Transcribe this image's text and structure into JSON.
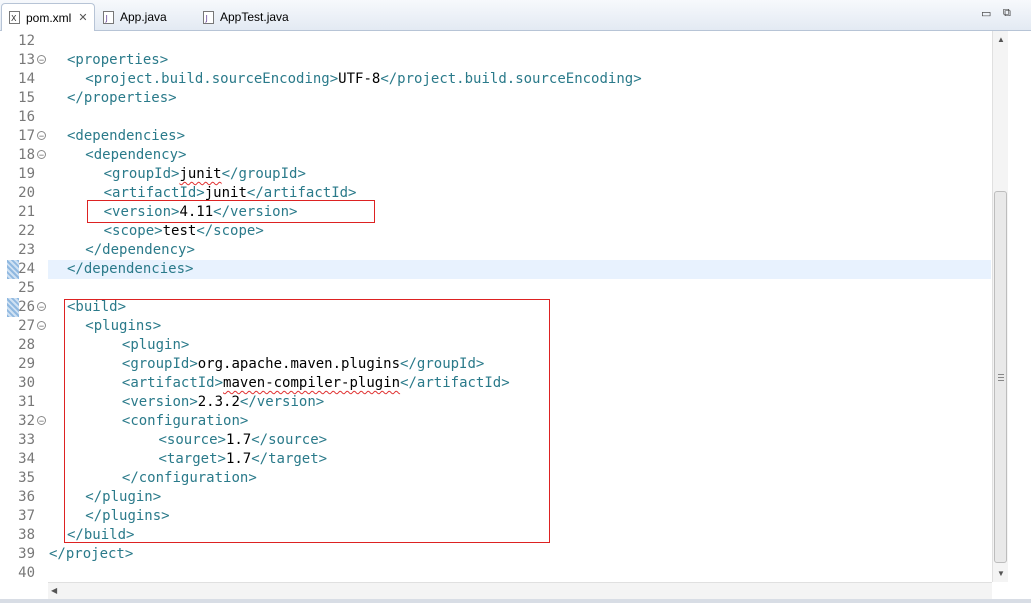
{
  "tabs": [
    {
      "label": "pom.xml",
      "active": true,
      "icon": "xml-file-icon"
    },
    {
      "label": "App.java",
      "active": false,
      "icon": "java-file-icon"
    },
    {
      "label": "AppTest.java",
      "active": false,
      "icon": "java-file-icon"
    }
  ],
  "window_controls": {
    "minimize": "▭",
    "maximize": "⧉"
  },
  "lines": [
    {
      "num": "12",
      "indent": 0,
      "parts": []
    },
    {
      "num": "13",
      "fold": true,
      "indent": 1,
      "parts": [
        [
          "tag",
          "<properties>"
        ]
      ]
    },
    {
      "num": "14",
      "indent": 2,
      "parts": [
        [
          "tag",
          "<project.build.sourceEncoding>"
        ],
        [
          "txt",
          "UTF-8"
        ],
        [
          "tag",
          "</project.build.sourceEncoding>"
        ]
      ]
    },
    {
      "num": "15",
      "indent": 1,
      "parts": [
        [
          "tag",
          "</properties>"
        ]
      ]
    },
    {
      "num": "16",
      "indent": 0,
      "parts": []
    },
    {
      "num": "17",
      "fold": true,
      "indent": 1,
      "parts": [
        [
          "tag",
          "<dependencies>"
        ]
      ]
    },
    {
      "num": "18",
      "fold": true,
      "indent": 2,
      "parts": [
        [
          "tag",
          "<dependency>"
        ]
      ]
    },
    {
      "num": "19",
      "indent": 3,
      "parts": [
        [
          "tag",
          "<groupId>"
        ],
        [
          "squig",
          "junit"
        ],
        [
          "tag",
          "</groupId>"
        ]
      ]
    },
    {
      "num": "20",
      "indent": 3,
      "parts": [
        [
          "tag",
          "<artifactId>"
        ],
        [
          "txt",
          "junit"
        ],
        [
          "tag",
          "</artifactId>"
        ]
      ]
    },
    {
      "num": "21",
      "indent": 3,
      "parts": [
        [
          "tag",
          "<version>"
        ],
        [
          "txt",
          "4.11"
        ],
        [
          "tag",
          "</version>"
        ]
      ]
    },
    {
      "num": "22",
      "indent": 3,
      "parts": [
        [
          "tag",
          "<scope>"
        ],
        [
          "txt",
          "test"
        ],
        [
          "tag",
          "</scope>"
        ]
      ]
    },
    {
      "num": "23",
      "indent": 2,
      "parts": [
        [
          "tag",
          "</dependency>"
        ]
      ]
    },
    {
      "num": "24",
      "indent": 1,
      "marker": true,
      "highlight": true,
      "parts": [
        [
          "tag",
          "</dependencies>"
        ]
      ]
    },
    {
      "num": "25",
      "indent": 0,
      "parts": []
    },
    {
      "num": "26",
      "fold": true,
      "indent": 1,
      "marker": true,
      "parts": [
        [
          "tag",
          "<build>"
        ]
      ]
    },
    {
      "num": "27",
      "fold": true,
      "indent": 2,
      "parts": [
        [
          "tag",
          "<plugins>"
        ]
      ]
    },
    {
      "num": "28",
      "indent": 4,
      "parts": [
        [
          "tag",
          "<plugin>"
        ]
      ]
    },
    {
      "num": "29",
      "indent": 4,
      "parts": [
        [
          "tag",
          "<groupId>"
        ],
        [
          "txt",
          "org.apache.maven.plugins"
        ],
        [
          "tag",
          "</groupId>"
        ]
      ]
    },
    {
      "num": "30",
      "indent": 4,
      "parts": [
        [
          "tag",
          "<artifactId>"
        ],
        [
          "squig",
          "maven-compiler-plugin"
        ],
        [
          "tag",
          "</artifactId>"
        ]
      ]
    },
    {
      "num": "31",
      "indent": 4,
      "parts": [
        [
          "tag",
          "<version>"
        ],
        [
          "txt",
          "2.3.2"
        ],
        [
          "tag",
          "</version>"
        ]
      ]
    },
    {
      "num": "32",
      "fold": true,
      "indent": 4,
      "parts": [
        [
          "tag",
          "<configuration>"
        ]
      ]
    },
    {
      "num": "33",
      "indent": 6,
      "parts": [
        [
          "tag",
          "<source>"
        ],
        [
          "txt",
          "1.7"
        ],
        [
          "tag",
          "</source>"
        ]
      ]
    },
    {
      "num": "34",
      "indent": 6,
      "parts": [
        [
          "tag",
          "<target>"
        ],
        [
          "txt",
          "1.7"
        ],
        [
          "tag",
          "</target>"
        ]
      ]
    },
    {
      "num": "35",
      "indent": 4,
      "parts": [
        [
          "tag",
          "</configuration>"
        ]
      ]
    },
    {
      "num": "36",
      "indent": 2,
      "parts": [
        [
          "tag",
          "</plugin>"
        ]
      ]
    },
    {
      "num": "37",
      "indent": 2,
      "parts": [
        [
          "tag",
          "</plugins>"
        ]
      ]
    },
    {
      "num": "38",
      "indent": 1,
      "parts": [
        [
          "tag",
          "</build>"
        ]
      ]
    },
    {
      "num": "39",
      "indent": 0,
      "parts": [
        [
          "tag",
          "</project>"
        ]
      ]
    },
    {
      "num": "40",
      "indent": 0,
      "parts": []
    }
  ]
}
